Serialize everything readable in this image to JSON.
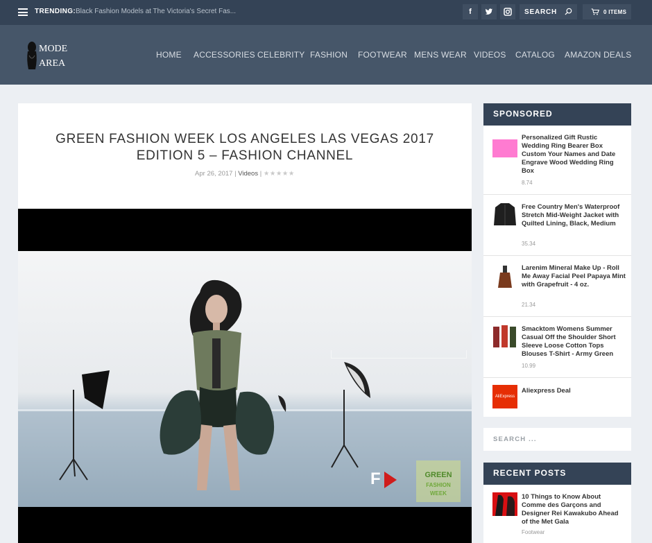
{
  "topbar": {
    "trending_label": "TRENDING:",
    "trending_text": "Black Fashion Models at The Victoria's Secret Fas...",
    "social": [
      {
        "name": "facebook-icon",
        "glyph": "f"
      },
      {
        "name": "twitter-icon",
        "glyph": "t"
      },
      {
        "name": "instagram-icon",
        "glyph": "◙"
      }
    ],
    "search_placeholder": "SEARCH",
    "cart_label": "0 ITEMS"
  },
  "header": {
    "logo_line1": "MODE",
    "logo_line2": "AREA",
    "nav": [
      "HOME",
      "ACCESSORIES",
      "CELEBRITY",
      "FASHION",
      "FOOTWEAR",
      "MENS WEAR",
      "VIDEOS",
      "CATALOG",
      "AMAZON DEALS"
    ]
  },
  "article": {
    "title": "GREEN FASHION WEEK LOS ANGELES LAS VEGAS 2017 EDITION 5 – FASHION CHANNEL",
    "date": "Apr 26, 2017",
    "separator": "|",
    "category": "Videos",
    "rating_stars": "★★★★★",
    "rating_value": 0,
    "video": {
      "channel_logo": "F",
      "watermark_line1": "GREEN",
      "watermark_line2": "FASHION",
      "watermark_line3": "WEEK"
    }
  },
  "sidebar": {
    "sponsored_title": "SPONSORED",
    "sponsored": [
      {
        "title": "Personalized Gift Rustic Wedding Ring Bearer Box Custom Your Names and Date Engrave Wood Wedding Ring Box",
        "price": "8.74",
        "thumb": "pink-box"
      },
      {
        "title": "Free Country Men's Waterproof Stretch Mid-Weight Jacket with Quilted Lining, Black, Medium",
        "price": "35.34",
        "thumb": "black-jacket"
      },
      {
        "title": "Larenim Mineral Make Up - Roll Me Away Facial Peel Papaya Mint with Grapefruit - 4 oz.",
        "price": "21.34",
        "thumb": "bottle"
      },
      {
        "title": "Smacktom Womens Summer Casual Off the Shoulder Short Sleeve Loose Cotton Tops Blouses T-Shirt - Army Green",
        "price": "10.99",
        "thumb": "women-tops"
      },
      {
        "title": "Aliexpress Deal",
        "price": "",
        "thumb": "aliexpress-logo",
        "thumb_text": "AliExpress"
      }
    ],
    "search_placeholder": "SEARCH ...",
    "recent_title": "RECENT POSTS",
    "recent": [
      {
        "title": "10 Things to Know About Comme des Garçons and Designer Rei Kawakubo Ahead of the Met Gala",
        "category": "Footwear"
      }
    ]
  },
  "colors": {
    "topbar_bg": "#344356",
    "header_bg": "#465669",
    "page_bg": "#eceff3",
    "widget_title_bg": "#344356",
    "aliexpress_red": "#e62e04"
  }
}
